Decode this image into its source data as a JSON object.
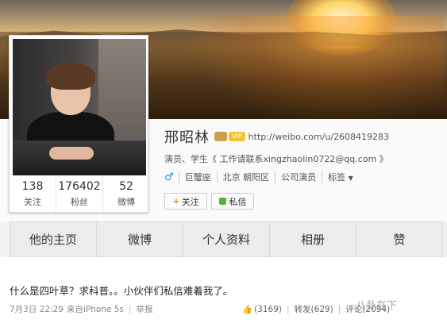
{
  "profile": {
    "name": "邢昭林",
    "vip_text": "VIP",
    "url": "http://weibo.com/u/2608419283",
    "bio": "演员、学生《 工作请联系xingzhaolin0722@qq.com 》",
    "gender_icon": "male-icon",
    "tags": [
      "巨蟹座",
      "北京 朝阳区",
      "公司演员"
    ],
    "more_tags": "标签",
    "follow_label": "关注",
    "follow_plus": "+",
    "message_label": "私信"
  },
  "stats": [
    {
      "value": "138",
      "label": "关注"
    },
    {
      "value": "176402",
      "label": "粉丝"
    },
    {
      "value": "52",
      "label": "微博"
    }
  ],
  "tabs": [
    {
      "label": "他的主页"
    },
    {
      "label": "微博"
    },
    {
      "label": "个人资料"
    },
    {
      "label": "相册"
    },
    {
      "label": "赞"
    }
  ],
  "post": {
    "text": "什么是四叶草？求科普。。小伙伴们私信难着我了。",
    "date": "7月3日 22:29",
    "source": "来自iPhone 5s",
    "report": "举报",
    "likes": "(3169)",
    "repost": "转发(629)",
    "comment": "评论(2094)"
  },
  "watermark": "八卦在下",
  "colors": {
    "accent_orange": "#f18a12",
    "link_blue": "#2d8ed8",
    "message_green": "#53b33a"
  }
}
